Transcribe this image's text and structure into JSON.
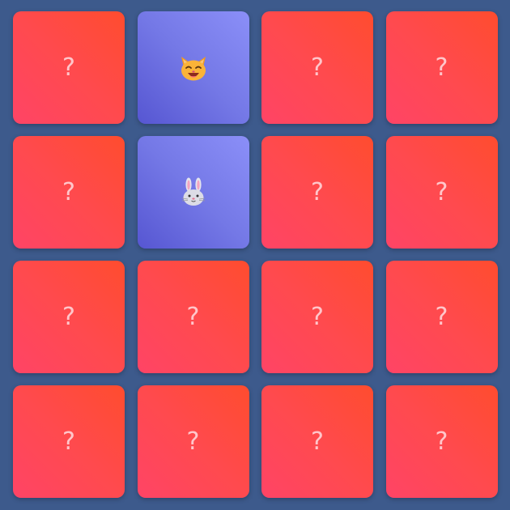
{
  "board": {
    "rows": 4,
    "cols": 4,
    "hidden_mark": "?",
    "cards": [
      {
        "state": "hidden"
      },
      {
        "state": "revealed",
        "icon": "cat-face-icon"
      },
      {
        "state": "hidden"
      },
      {
        "state": "hidden"
      },
      {
        "state": "hidden"
      },
      {
        "state": "revealed",
        "icon": "rabbit-face-icon"
      },
      {
        "state": "hidden"
      },
      {
        "state": "hidden"
      },
      {
        "state": "hidden"
      },
      {
        "state": "hidden"
      },
      {
        "state": "hidden"
      },
      {
        "state": "hidden"
      },
      {
        "state": "hidden"
      },
      {
        "state": "hidden"
      },
      {
        "state": "hidden"
      },
      {
        "state": "hidden"
      }
    ]
  },
  "colors": {
    "background": "#3d5a8c",
    "card_back_start": "#ff4466",
    "card_back_end": "#ff4c2e",
    "card_face_start": "#5656d2",
    "card_face_end": "#8b8ff8"
  }
}
